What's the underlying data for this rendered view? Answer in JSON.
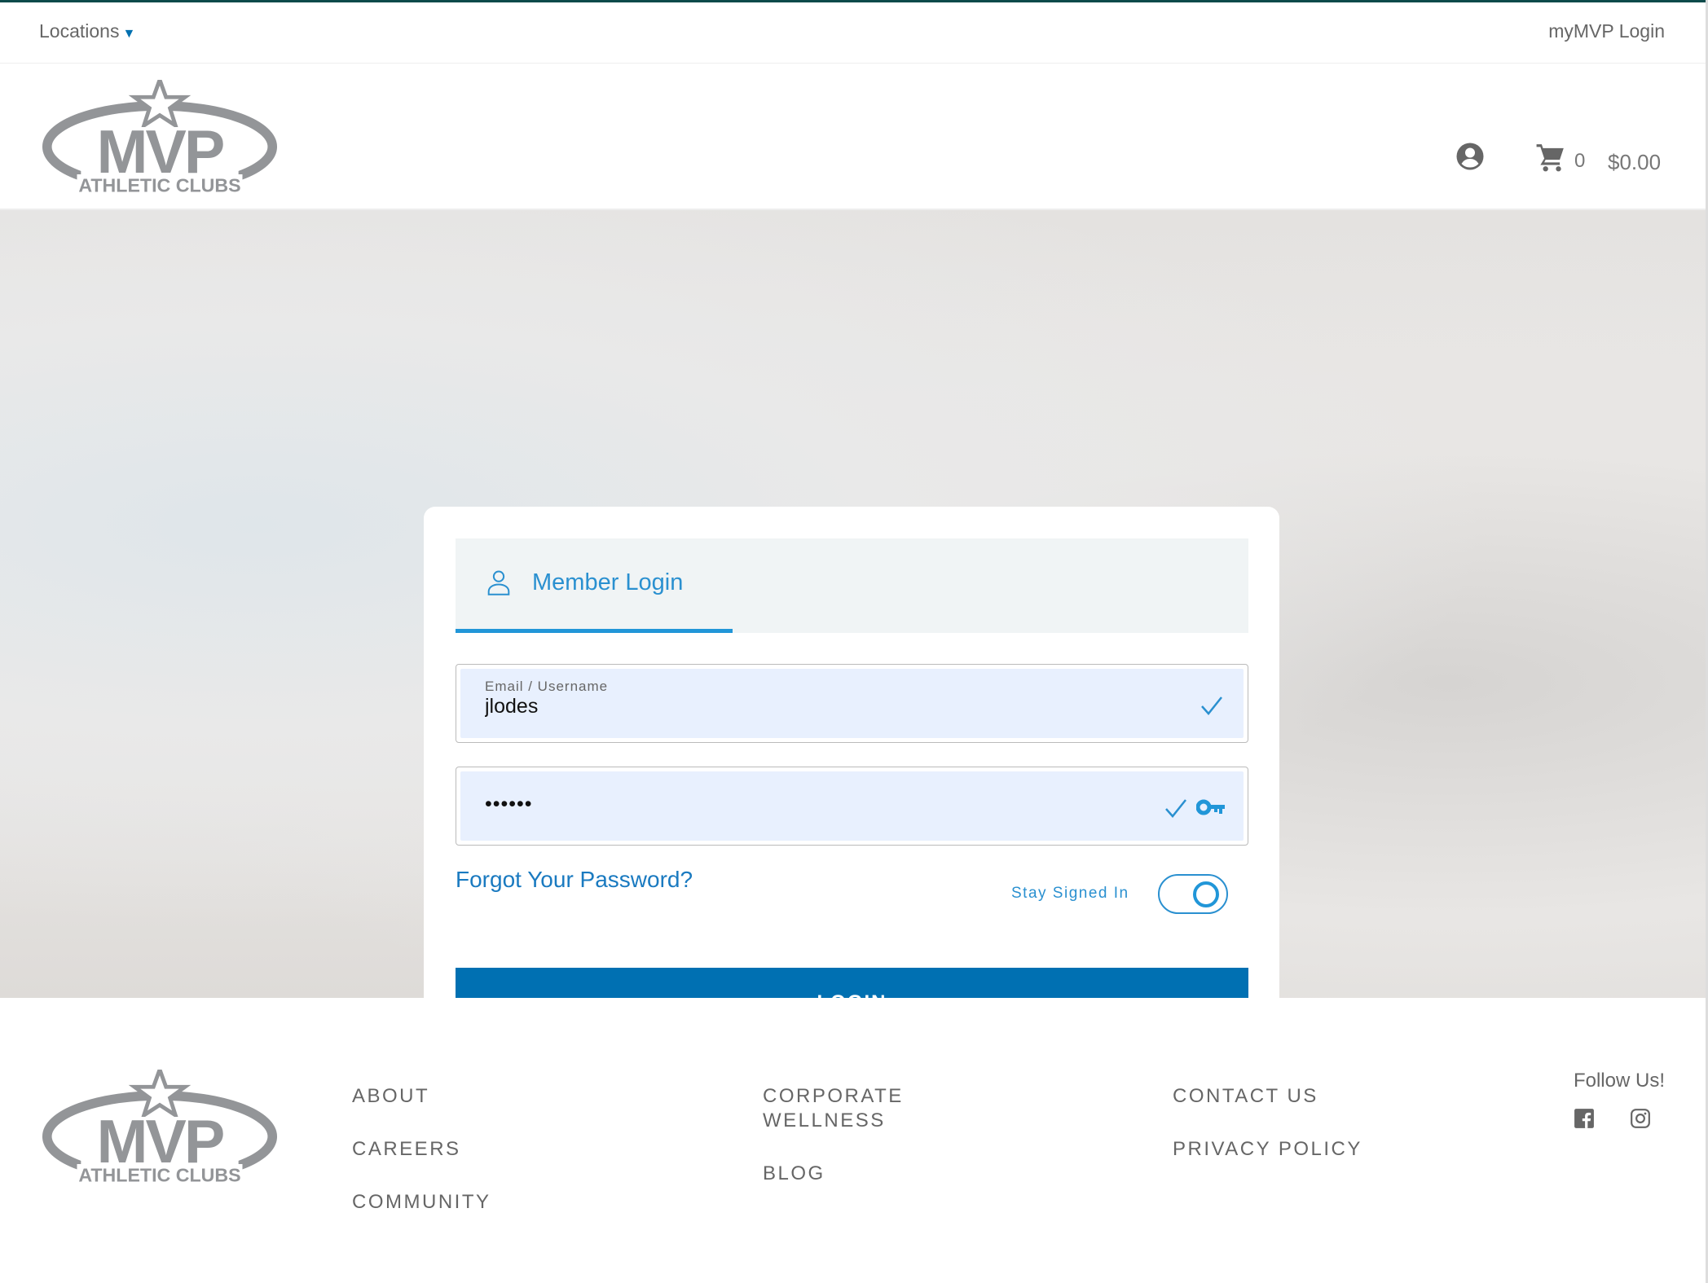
{
  "topbar": {
    "locations_label": "Locations",
    "mymvp_login": "myMVP Login"
  },
  "brand": {
    "name": "MVP",
    "subtitle": "ATHLETIC CLUBS",
    "logo_color": "#939598"
  },
  "header": {
    "cart_count": "0",
    "cart_total": "$0.00"
  },
  "login_card": {
    "tab_label": "Member Login",
    "email_label": "Email / Username",
    "email_value": "jlodes",
    "password_value": "••••••",
    "forgot_link": "Forgot Your Password?",
    "stay_signed_in": "Stay Signed In",
    "stay_signed_in_on": true,
    "login_button": "LOGIN"
  },
  "footer": {
    "links": [
      "ABOUT",
      "CAREERS",
      "COMMUNITY",
      "CORPORATE WELLNESS",
      "BLOG",
      "CONTACT US",
      "PRIVACY POLICY"
    ],
    "follow_us": "Follow Us!",
    "social": [
      "facebook-icon",
      "instagram-icon"
    ]
  },
  "colors": {
    "accent": "#2196d8",
    "button": "#0070b2",
    "topbar_border": "#0d4a4a"
  }
}
